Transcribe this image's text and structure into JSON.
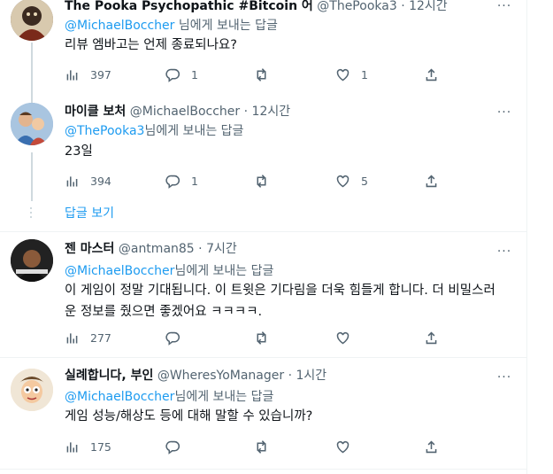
{
  "tweets": [
    {
      "name": "The Pooka Psychopathic #Bitcoin 어",
      "handle": "@ThePooka3",
      "time": "12시간",
      "reply_to_handle": "@MichaelBoccher",
      "reply_to_suffix": " 님에게 보내는 답글",
      "text": "리뷰 엠바고는 언제 종료되나요?",
      "stats": {
        "views": "397",
        "replies": "1",
        "retweets": "",
        "likes": "1"
      }
    },
    {
      "name": "마이클 보처",
      "handle": "@MichaelBoccher",
      "time": "12시간",
      "reply_to_handle": "@ThePooka3",
      "reply_to_suffix": "님에게 보내는 답글",
      "text": "23일",
      "stats": {
        "views": "394",
        "replies": "1",
        "retweets": "",
        "likes": "5"
      }
    },
    {
      "name": "젠 마스터",
      "handle": "@antman85",
      "time": "7시간",
      "reply_to_handle": "@MichaelBoccher",
      "reply_to_suffix": "님에게 보내는 답글",
      "text": "이 게임이 정말 기대됩니다. 이 트윗은 기다림을 더욱 힘들게 합니다. 더 비밀스러운 정보를 줬으면 좋겠어요 ㅋㅋㅋㅋ.",
      "stats": {
        "views": "277",
        "replies": "",
        "retweets": "",
        "likes": ""
      }
    },
    {
      "name": "실례합니다, 부인",
      "handle": "@WheresYoManager",
      "time": "1시간",
      "reply_to_handle": "@MichaelBoccher",
      "reply_to_suffix": "님에게 보내는 답글",
      "text": "게임 성능/해상도 등에 대해 말할 수 있습니까?",
      "stats": {
        "views": "175",
        "replies": "",
        "retweets": "",
        "likes": ""
      }
    }
  ],
  "show_replies_label": "답글 보기",
  "dot": "·",
  "more_glyph": "···",
  "colors": {
    "accent": "#1d9bf0",
    "secondary_text": "#536471",
    "border": "#eff3f4"
  }
}
